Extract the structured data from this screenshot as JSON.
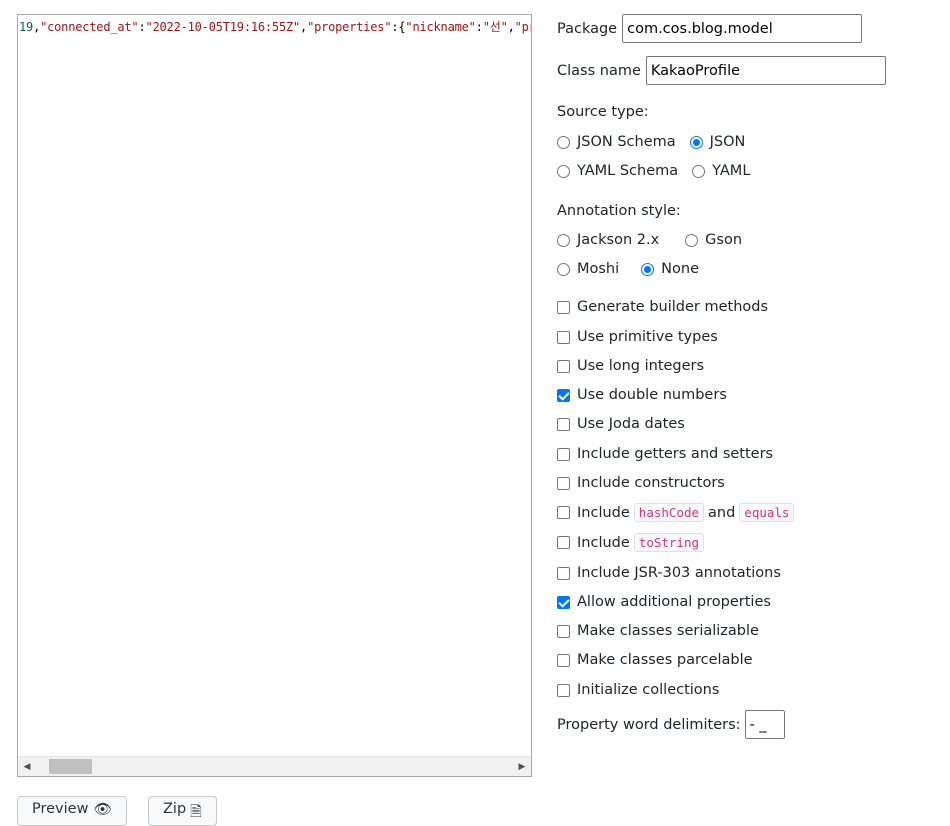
{
  "editor": {
    "tokens": {
      "t0": "19",
      "t1": ",",
      "t2": "\"connected_at\"",
      "t3": ":",
      "t4": "\"2022-10-05T19:16:55Z\"",
      "t5": ",",
      "t6": "\"properties\"",
      "t7": ":{",
      "t8": "\"nickname\"",
      "t9": ":",
      "t10": "\"선\"",
      "t11": ",",
      "t12": "\"pr"
    }
  },
  "form": {
    "package_label": "Package",
    "package_value": "com.cos.blog.model",
    "classname_label": "Class name",
    "classname_value": "KakaoProfile",
    "source_type_label": "Source type:",
    "source_types": [
      {
        "label": "JSON Schema",
        "checked": false
      },
      {
        "label": "JSON",
        "checked": true
      },
      {
        "label": "YAML Schema",
        "checked": false
      },
      {
        "label": "YAML",
        "checked": false
      }
    ],
    "annotation_label": "Annotation style:",
    "annotation_styles": [
      {
        "label": "Jackson 2.x",
        "checked": false
      },
      {
        "label": "Gson",
        "checked": false
      },
      {
        "label": "Moshi",
        "checked": false
      },
      {
        "label": "None",
        "checked": true
      }
    ],
    "options": {
      "builder": {
        "label": "Generate builder methods",
        "checked": false
      },
      "primitive": {
        "label": "Use primitive types",
        "checked": false
      },
      "long_int": {
        "label": "Use long integers",
        "checked": false
      },
      "double_num": {
        "label": "Use double numbers",
        "checked": true
      },
      "joda": {
        "label": "Use Joda dates",
        "checked": false
      },
      "getters": {
        "label": "Include getters and setters",
        "checked": false
      },
      "constructors": {
        "label": "Include constructors",
        "checked": false
      },
      "hashcode": {
        "prefix": "Include",
        "code1": "hashCode",
        "mid": "and",
        "code2": "equals",
        "checked": false
      },
      "tostring": {
        "prefix": "Include",
        "code1": "toString",
        "checked": false
      },
      "jsr303": {
        "label": "Include JSR-303 annotations",
        "checked": false
      },
      "additional": {
        "label": "Allow additional properties",
        "checked": true
      },
      "serializable": {
        "label": "Make classes serializable",
        "checked": false
      },
      "parcelable": {
        "label": "Make classes parcelable",
        "checked": false
      },
      "init_collections": {
        "label": "Initialize collections",
        "checked": false
      }
    },
    "delimiters_label": "Property word delimiters:",
    "delimiters_value": "- _"
  },
  "buttons": {
    "preview_label": "Preview",
    "zip_label": "Zip"
  },
  "colors": {
    "accent": "#0075ff",
    "code_chip": "#d63384",
    "json_string": "#a31515",
    "json_number": "#116644"
  }
}
